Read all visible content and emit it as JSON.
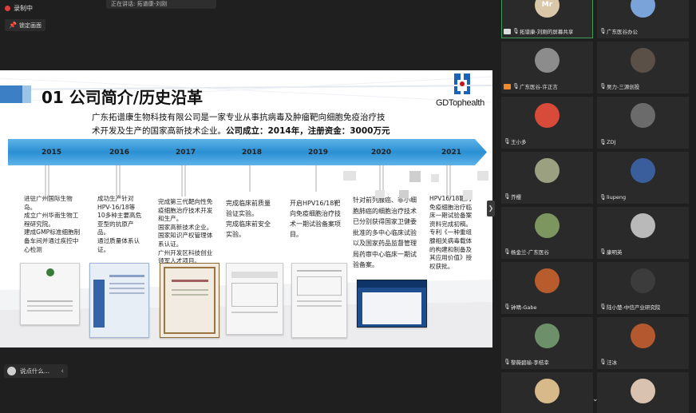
{
  "overlay": {
    "recording_label": "录制中",
    "pin_label": "锁定画面",
    "speaker_label": "正在讲话: 拓谱康-刘刚"
  },
  "slide": {
    "title": "01 公司简介/历史沿革",
    "logo_text": "GDTophealth",
    "intro_line1": "广东拓谱康生物科技有限公司是一家专业从事抗病毒及肿瘤靶向细胞免疫治疗技",
    "intro_line2_plain": "术开发及生产的国家高新技术企业。",
    "intro_line2_bold": "公司成立：2014年，注册资金：3000万元",
    "years": [
      "2015",
      "2016",
      "2017",
      "2018",
      "2019",
      "2020",
      "2021"
    ],
    "milestones": [
      "进驻广州国际生物岛。\n成立广州华南生物工程研究院。\n建成GMP标准细胞制备车间并通过疾控中心检测",
      "成功生产针对HPV-16/18等10多种主要高危亚型的抗原产品。\n通过质量体系认证。",
      "完成第三代靶向性免疫细胞治疗技术开发和生产。\n国家高新技术企业。\n国家知识产权管理体系认证。\n广州开发区科技创业领军人才项目。",
      "完成临床前质量验证实验。\n完成临床前安全实验。",
      "开启HPV16/18靶向免疫细胞治疗技术一期试验备案项目。",
      "针对前列腺癌、非小细胞肺癌的细胞治疗技术已分别获得国家卫健委批准的多中心临床试验以及国家药品监督管理局药审中心临床一期试验备案。",
      "HPV16/18靶向免疫细胞治疗临床一期试验备案资料完成初稿。\n专利《一种重组腺相关病毒载体的构建和制备及其应用价值》授权获批。"
    ]
  },
  "chat": {
    "placeholder": "说点什么..."
  },
  "participants": [
    {
      "name": "拓谱康-刘刚的屏幕共享",
      "avatar": "Mr",
      "color": "#d9c7a8",
      "tag": "screen",
      "active": true
    },
    {
      "name": "广东医谷办公",
      "avatar": "",
      "color": "#7aa3d9",
      "tag": "",
      "active": false
    },
    {
      "name": "广东医谷-许正言",
      "avatar": "",
      "color": "#8c8c8c",
      "tag": "orange",
      "active": false
    },
    {
      "name": "吴力-三源创投",
      "avatar": "",
      "color": "#5b5048",
      "tag": "",
      "active": false
    },
    {
      "name": "王小多",
      "avatar": "",
      "color": "#d84a3a",
      "tag": "",
      "active": false
    },
    {
      "name": "ZDJ",
      "avatar": "",
      "color": "#6b6b6b",
      "tag": "",
      "active": false
    },
    {
      "name": "芥樱",
      "avatar": "",
      "color": "#9aa080",
      "tag": "",
      "active": false
    },
    {
      "name": "liupeng",
      "avatar": "",
      "color": "#3a5e9c",
      "tag": "",
      "active": false
    },
    {
      "name": "杨金兰-广东医谷",
      "avatar": "",
      "color": "#7d9660",
      "tag": "",
      "active": false
    },
    {
      "name": "康明英",
      "avatar": "",
      "color": "#b9b9b9",
      "tag": "",
      "active": false
    },
    {
      "name": "钟晴-Gabe",
      "avatar": "",
      "color": "#b85c2e",
      "tag": "",
      "active": false
    },
    {
      "name": "陆小楚-中信产业研究院",
      "avatar": "",
      "color": "#3c3c3c",
      "tag": "",
      "active": false
    },
    {
      "name": "黎薇碧瑜-李桔幸",
      "avatar": "",
      "color": "#6d8f6a",
      "tag": "",
      "active": false
    },
    {
      "name": "汪冰",
      "avatar": "",
      "color": "#b3582f",
      "tag": "",
      "active": false
    },
    {
      "name": "",
      "avatar": "",
      "color": "#d8b98a",
      "tag": "",
      "active": false
    },
    {
      "name": "",
      "avatar": "",
      "color": "#d9c3b0",
      "tag": "",
      "active": false
    }
  ]
}
